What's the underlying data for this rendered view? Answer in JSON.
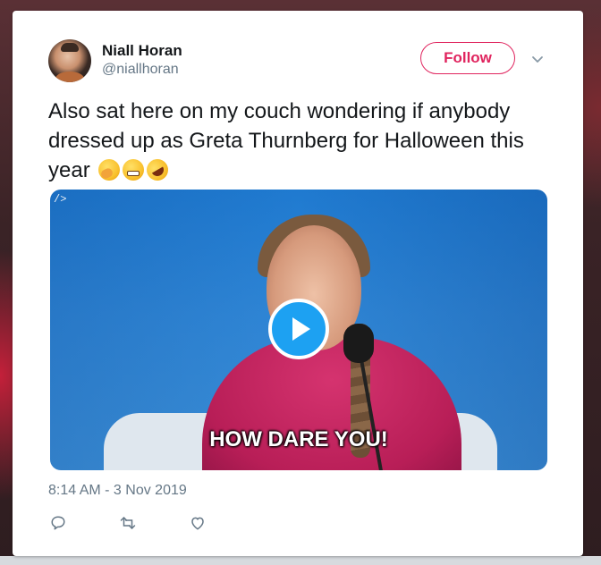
{
  "tweet": {
    "author_name": "Niall Horan",
    "author_handle": "@niallhoran",
    "follow_label": "Follow",
    "text": "Also sat here on my couch wondering if anybody dressed up as Greta Thurnberg for Halloween this year ",
    "emojis": [
      "face-with-hand-over-mouth-emoji",
      "grimacing-face-emoji",
      "rolling-on-floor-laughing-emoji"
    ],
    "media": {
      "corner_tag": "/>",
      "caption": "HOW DARE YOU!",
      "play_icon": "play-icon"
    },
    "timestamp": "8:14 AM - 3 Nov 2019",
    "actions": [
      "reply-icon",
      "retweet-icon",
      "like-icon"
    ]
  },
  "colors": {
    "follow": "#e0245e",
    "play": "#1da1f2",
    "text": "#14171a",
    "muted": "#657786"
  }
}
